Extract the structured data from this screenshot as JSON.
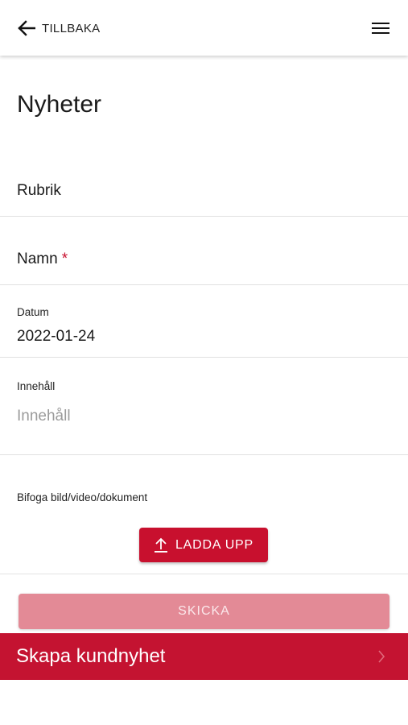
{
  "header": {
    "back_label": "TILLBAKA",
    "back_icon": "arrow-left-icon",
    "menu_icon": "hamburger-menu-icon"
  },
  "page": {
    "title": "Nyheter"
  },
  "form": {
    "rubrik_label": "Rubrik",
    "namn_label": "Namn",
    "namn_required": "*",
    "datum_label": "Datum",
    "datum_value": "2022-01-24",
    "innehall_label": "Innehåll",
    "innehall_placeholder": "Innehåll",
    "bifoga_label": "Bifoga bild/video/dokument",
    "upload_label": "LADDA UPP",
    "upload_icon": "upload-icon",
    "submit_label": "SKICKA"
  },
  "bottom_bar": {
    "label": "Skapa kundnyhet",
    "icon": "chevron-right-icon"
  },
  "colors": {
    "accent": "#c8102e",
    "submit_disabled": "#e38a96",
    "bottom_bar": "#c41331",
    "placeholder": "#9b9b9b"
  }
}
